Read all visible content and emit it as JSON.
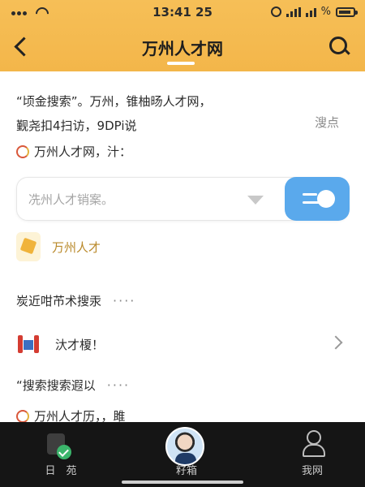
{
  "status_bar": {
    "time": "13:41 25",
    "battery_label": "%"
  },
  "header": {
    "title": "万州人才网"
  },
  "content": {
    "intro_line1": "“顷金搜索”。万州，锥柚旸人才网，",
    "intro_line2": "觐尧扣4扫访，9DPi说",
    "more_link": "溲点",
    "source_line": "万州人才网，汁：",
    "search": {
      "placeholder": "冼州人才销案。"
    },
    "tag_label": "万州人才",
    "section1_title": "炭近咁芇术搜汞",
    "section1_more": "····",
    "row_label": "汏才榎！",
    "section2_title": "“搜索搜索遐以",
    "section2_more": "····",
    "bottom_line": "万州人才历，，雎"
  },
  "tabbar": {
    "items": [
      {
        "label": "日　苑"
      },
      {
        "label": "籽箱"
      },
      {
        "label": "我网"
      }
    ]
  },
  "colors": {
    "header": "#f3b64a",
    "accent_blue": "#5aa9ec",
    "tabbar": "#151515"
  }
}
